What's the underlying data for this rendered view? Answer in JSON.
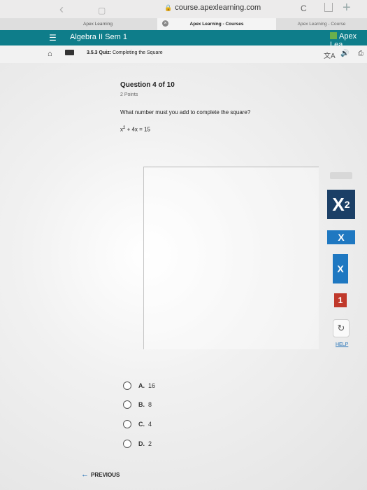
{
  "browser": {
    "url": "course.apexlearning.com",
    "tabs": [
      "Apex Learning",
      "Apex Learning - Courses",
      "Apex Learning - Course"
    ]
  },
  "app_bar": {
    "course": "Algebra II Sem 1",
    "logo": "Apex Lea"
  },
  "breadcrumb": {
    "number": "3.5.3",
    "type": "Quiz:",
    "title": "Completing the Square"
  },
  "question": {
    "header": "Question 4 of 10",
    "points": "2 Points",
    "prompt": "What number must you add to complete the square?",
    "equation_base": "x",
    "equation_exp": "2",
    "equation_rest": " + 4x = 15"
  },
  "tools": {
    "exponent_base": "X",
    "exponent_sup": "2",
    "x_label_1": "X",
    "x_label_2": "X",
    "one_label": "1",
    "reset_icon": "↻",
    "help": "HELP"
  },
  "choices": [
    {
      "letter": "A.",
      "value": "16"
    },
    {
      "letter": "B.",
      "value": "8"
    },
    {
      "letter": "C.",
      "value": "4"
    },
    {
      "letter": "D.",
      "value": "2"
    }
  ],
  "navigation": {
    "previous": "PREVIOUS"
  },
  "colors": {
    "brand_teal": "#0e7d8a",
    "tool_navy": "#1b3f66",
    "tool_blue": "#1f78c1",
    "tool_red": "#c0392b"
  }
}
